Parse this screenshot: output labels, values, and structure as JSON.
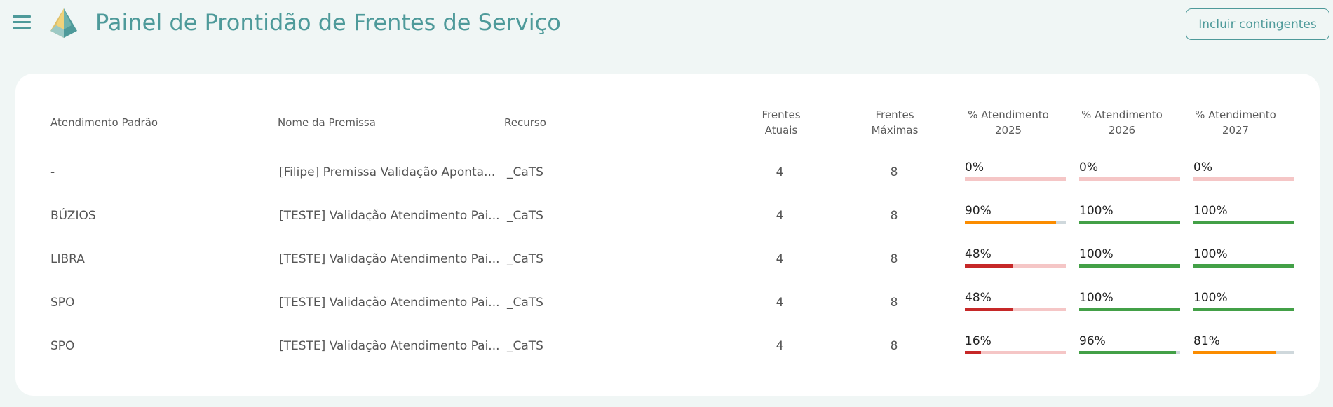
{
  "header": {
    "title": "Painel de Prontidão de Frentes de Serviço",
    "contingency_button": "Incluir contingentes"
  },
  "table": {
    "columns": {
      "atendimento": "Atendimento Padrão",
      "premissa": "Nome da Premissa",
      "recurso": "Recurso",
      "frentes_atuais_1": "Frentes",
      "frentes_atuais_2": "Atuais",
      "frentes_max_1": "Frentes",
      "frentes_max_2": "Máximas",
      "pct_1": "% Atendimento",
      "y2025": "2025",
      "y2026": "2026",
      "y2027": "2027"
    },
    "rows": [
      {
        "atendimento": "-",
        "premissa": "[Filipe] Premissa Validação Aponta...",
        "recurso": "_CaTS",
        "atuais": "4",
        "maximas": "8",
        "p2025": "0%",
        "p2026": "0%",
        "p2027": "0%",
        "v2025": 0,
        "v2026": 0,
        "v2027": 0
      },
      {
        "atendimento": "BÚZIOS",
        "premissa": "[TESTE] Validação Atendimento Pai...",
        "recurso": "_CaTS",
        "atuais": "4",
        "maximas": "8",
        "p2025": "90%",
        "p2026": "100%",
        "p2027": "100%",
        "v2025": 90,
        "v2026": 100,
        "v2027": 100
      },
      {
        "atendimento": "LIBRA",
        "premissa": "[TESTE] Validação Atendimento Pai...",
        "recurso": "_CaTS",
        "atuais": "4",
        "maximas": "8",
        "p2025": "48%",
        "p2026": "100%",
        "p2027": "100%",
        "v2025": 48,
        "v2026": 100,
        "v2027": 100
      },
      {
        "atendimento": "SPO",
        "premissa": "[TESTE] Validação Atendimento Pai...",
        "recurso": "_CaTS",
        "atuais": "4",
        "maximas": "8",
        "p2025": "48%",
        "p2026": "100%",
        "p2027": "100%",
        "v2025": 48,
        "v2026": 100,
        "v2027": 100
      },
      {
        "atendimento": "SPO",
        "premissa": "[TESTE] Validação Atendimento Pai...",
        "recurso": "_CaTS",
        "atuais": "4",
        "maximas": "8",
        "p2025": "16%",
        "p2026": "96%",
        "p2027": "81%",
        "v2025": 16,
        "v2026": 96,
        "v2027": 81
      }
    ]
  },
  "colors": {
    "accent": "#4e9a9a",
    "green": "#43a047",
    "orange": "#fb8c00",
    "red": "#c62828",
    "track_red": "#f5c6c6",
    "track_grey": "#cfd8dc"
  },
  "icons": {
    "menu": "hamburger-menu-icon",
    "logo": "pyramid-logo-icon"
  }
}
